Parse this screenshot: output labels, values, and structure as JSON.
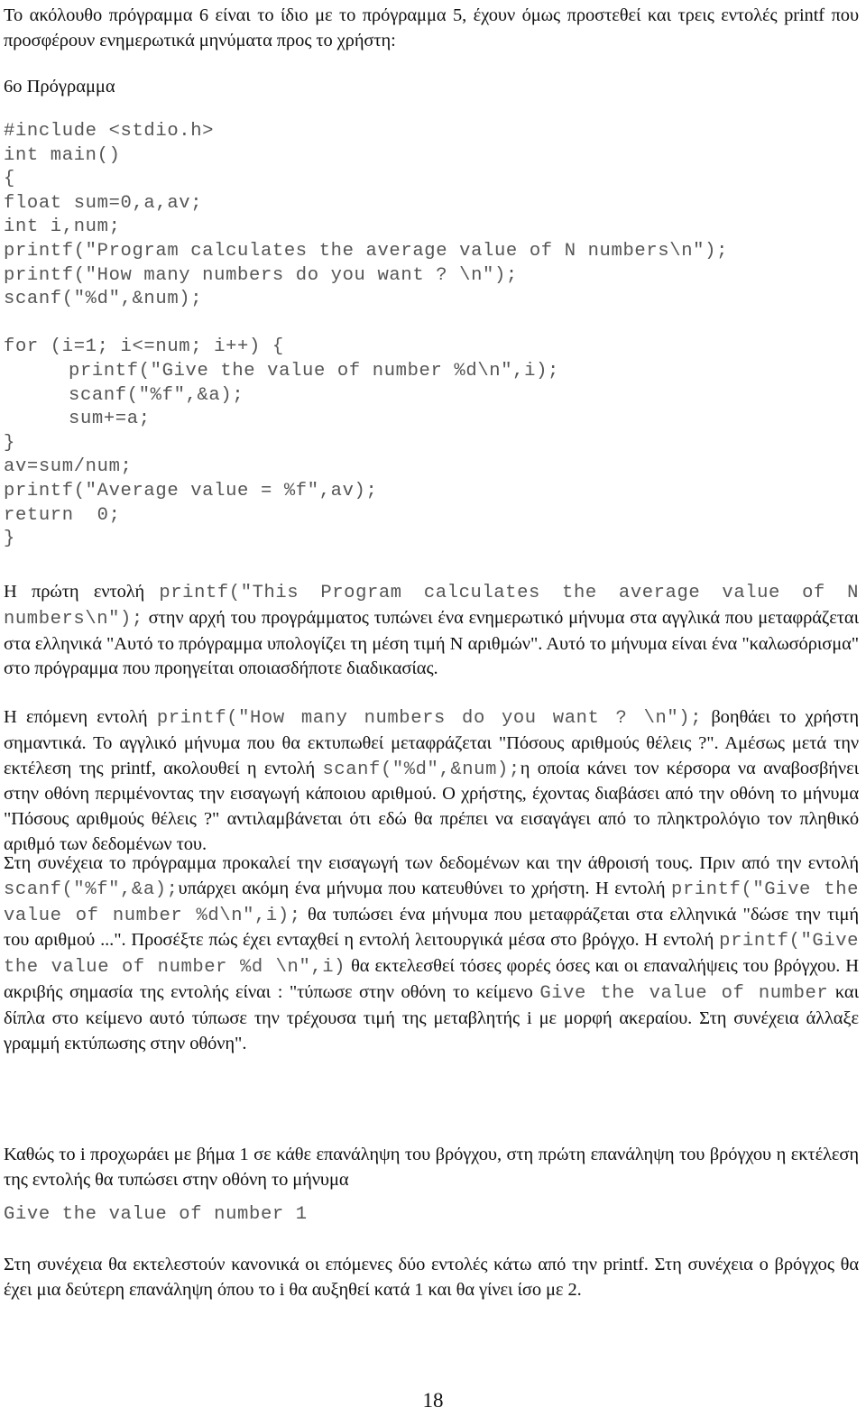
{
  "intro": {
    "text": "Το ακόλουθο πρόγραμμα 6 είναι το ίδιο με το πρόγραμμα 5, έχουν όμως προστεθεί και τρεις εντολές printf που προσφέρουν ενημερωτικά μηνύματα προς το χρήστη:"
  },
  "program_heading": "6ο Πρόγραμμα",
  "code_lines": [
    "#include <stdio.h>",
    "int main()",
    "{",
    "float sum=0,a,av;",
    "int i,num;",
    "printf(\"Program calculates the average value of N numbers\\n\");",
    "printf(\"How many numbers do you want ? \\n\");",
    "scanf(\"%d\",&num);",
    "",
    "for (i=1; i<=num; i++) {",
    "printf(\"Give the value of number %d\\n\",i);",
    "scanf(\"%f\",&a);",
    "sum+=a;",
    "}",
    "av=sum/num;",
    "printf(\"Average value = %f\",av);",
    "return  0;",
    "}"
  ],
  "para1": {
    "lead": "Η πρώτη εντολή ",
    "code": "printf(\"This Program calculates the average value of N numbers\\n\");",
    "rest": " στην αρχή του προγράμματος τυπώνει ένα ενημερωτικό μήνυμα στα αγγλικά που μεταφράζεται στα ελληνικά \"Αυτό το πρόγραμμα υπολογίζει τη μέση τιμή Ν αριθμών\". Αυτό το μήνυμα είναι ένα \"καλωσόρισμα\" στο πρόγραμμα που προηγείται οποιασδήποτε διαδικασίας."
  },
  "para2": {
    "lead": "Η επόμενη εντολή ",
    "code1": "printf(\"How many numbers do you want ? \\n\");",
    "mid1": " βοηθάει το χρήστη σημαντικά. Το αγγλικό μήνυμα που θα εκτυπωθεί μεταφράζεται \"Πόσους αριθμούς θέλεις ?\". Αμέσως μετά την εκτέλεση της printf, ακολουθεί η εντολή ",
    "code2": "scanf(\"%d\",&num);",
    "rest": "η οποία κάνει τον κέρσορα να αναβοσβήνει στην οθόνη περιμένοντας την εισαγωγή κάποιου αριθμού. Ο χρήστης, έχοντας διαβάσει από την οθόνη το μήνυμα \"Πόσους αριθμούς θέλεις ?\" αντιλαμβάνεται ότι εδώ θα πρέπει να εισαγάγει από το πληκτρολόγιο τον πληθικό αριθμό των δεδομένων του."
  },
  "para3": {
    "lead": "Στη συνέχεια το πρόγραμμα προκαλεί την εισαγωγή των δεδομένων και την άθροισή τους. Πριν από την εντολή ",
    "code1": "scanf(\"%f\",&a);",
    "mid1": "υπάρχει ακόμη ένα μήνυμα που κατευθύνει το χρήστη. Η εντολή ",
    "code2": "printf(\"Give the value of number %d\\n\",i);",
    "mid2": " θα τυπώσει ένα μήνυμα που μεταφράζεται στα ελληνικά \"δώσε την τιμή του αριθμού ...\". Προσέξτε πώς έχει ενταχθεί η εντολή λειτουργικά μέσα στο βρόγχο. Η εντολή ",
    "code3": "printf(\"Give the value of number %d \\n\",i)",
    "mid3": " θα εκτελεσθεί τόσες φορές όσες και οι επαναλήψεις του βρόγχου. Η ακριβής σημασία της εντολής είναι : \"τύπωσε στην οθόνη το κείμενο ",
    "code4": "Give the value of number",
    "rest": " και δίπλα στο κείμενο αυτό τύπωσε την τρέχουσα τιμή της μεταβλητής i με μορφή ακεραίου. Στη συνέχεια άλλαξε γραμμή εκτύπωσης στην οθόνη\"."
  },
  "para4": {
    "text": "Καθώς το i προχωράει με βήμα 1 σε κάθε επανάληψη του βρόγχου, στη πρώτη επανάληψη του βρόγχου η εκτέλεση της εντολής θα τυπώσει στην οθόνη το μήνυμα"
  },
  "output_example": "Give the value of number 1",
  "para5": {
    "text": "Στη συνέχεια θα εκτελεστούν κανονικά οι επόμενες δύο εντολές κάτω από την printf. Στη συνέχεια ο βρόγχος θα έχει μια δεύτερη επανάληψη όπου το i θα αυξηθεί κατά 1 και θα γίνει ίσο με 2."
  },
  "page_number": "18"
}
